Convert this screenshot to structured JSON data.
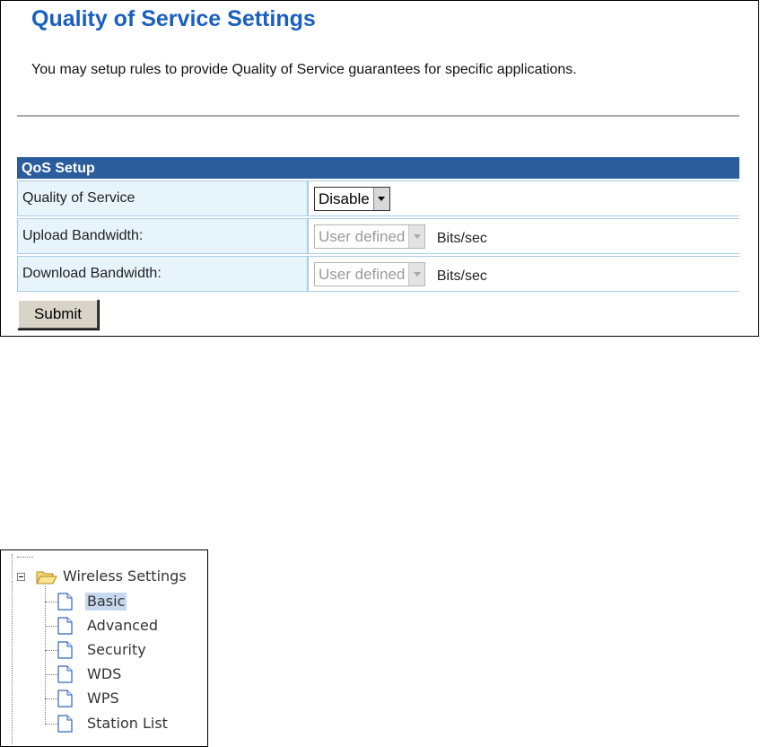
{
  "qos_panel": {
    "title": "Quality of Service Settings",
    "description": "You may setup rules to provide Quality of Service guarantees for specific applications.",
    "section_header": "QoS Setup",
    "rows": {
      "quality_of_service": {
        "label": "Quality of Service",
        "value": "Disable"
      },
      "upload_bandwidth": {
        "label": "Upload Bandwidth:",
        "value": "User defined",
        "unit": "Bits/sec"
      },
      "download_bandwidth": {
        "label": "Download Bandwidth:",
        "value": "User defined",
        "unit": "Bits/sec"
      }
    },
    "submit_label": "Submit"
  },
  "nav_tree": {
    "folder": {
      "label": "Wireless Settings",
      "expanded": true,
      "icon": "folder-open-icon"
    },
    "items": [
      {
        "label": "Basic",
        "selected": true,
        "icon": "page-icon"
      },
      {
        "label": "Advanced",
        "selected": false,
        "icon": "page-icon"
      },
      {
        "label": "Security",
        "selected": false,
        "icon": "page-icon"
      },
      {
        "label": "WDS",
        "selected": false,
        "icon": "page-icon"
      },
      {
        "label": "WPS",
        "selected": false,
        "icon": "page-icon"
      },
      {
        "label": "Station List",
        "selected": false,
        "icon": "page-icon"
      }
    ]
  },
  "colors": {
    "title": "#1a5fc0",
    "section_header_bg": "#2b5d9c",
    "label_cell_bg": "#e8f4fc",
    "selected_item_bg": "#c6d9ee"
  }
}
